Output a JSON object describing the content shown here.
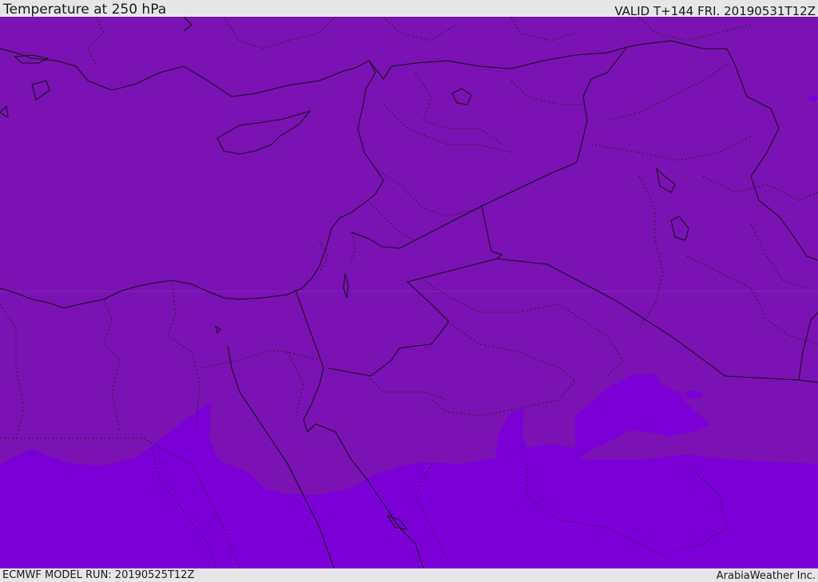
{
  "header": {
    "title": "Temperature at 250 hPa",
    "valid_time": "VALID T+144 FRI. 20190531T12Z"
  },
  "footer": {
    "model_run": "ECMWF MODEL RUN: 20190525T12Z",
    "credit": "ArabiaWeather Inc."
  },
  "map": {
    "field": "Temperature",
    "level": "250 hPa",
    "colors": {
      "cooler_band": "#7b12b3",
      "warmer_band": "#7b00d8",
      "coast_and_borders": "#111111"
    }
  }
}
